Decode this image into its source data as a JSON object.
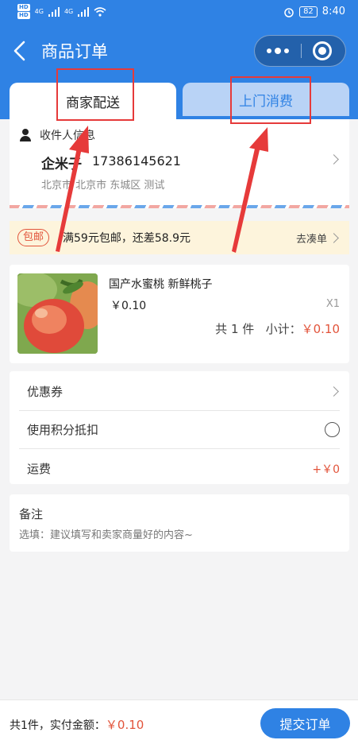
{
  "status_bar": {
    "hd_badges": [
      "HD",
      "HD"
    ],
    "signal_labels": [
      "4G",
      "4G"
    ],
    "battery": "82",
    "time": "8:40"
  },
  "header": {
    "title": "商品订单"
  },
  "tabs": [
    {
      "label": "商家配送",
      "active": true
    },
    {
      "label": "上门消费",
      "active": false
    }
  ],
  "address": {
    "heading": "收件人信息",
    "name": "企米子",
    "phone": "17386145621",
    "detail": "北京市 北京市 东城区 测试"
  },
  "shipping": {
    "badge": "包邮",
    "text": "满59元包邮，还差58.9元",
    "action": "去凑单"
  },
  "product": {
    "name": "国产水蜜桃 新鲜桃子",
    "price": "￥0.10",
    "quantity": "X1",
    "count_text": "共 1 件",
    "subtotal_label": "小计：",
    "subtotal": "￥0.10"
  },
  "options": {
    "coupon": "优惠券",
    "points": "使用积分抵扣",
    "freight_label": "运费",
    "freight_value": "+￥0"
  },
  "remark": {
    "title": "备注",
    "placeholder": "选填：建议填写和卖家商量好的内容~"
  },
  "footer": {
    "count_label": "共1件，实付金额：",
    "amount": "￥0.10",
    "submit_label": "提交订单"
  },
  "colors": {
    "primary": "#2f82e4",
    "price_red": "#e2543b",
    "annotation_red": "#e63a3a",
    "banner_bg": "#fdf4dc"
  },
  "icons": [
    "back-arrow-icon",
    "more-dots-icon",
    "close-target-icon",
    "person-icon",
    "chevron-right-icon",
    "radio-icon",
    "wifi-icon",
    "alarm-icon"
  ]
}
